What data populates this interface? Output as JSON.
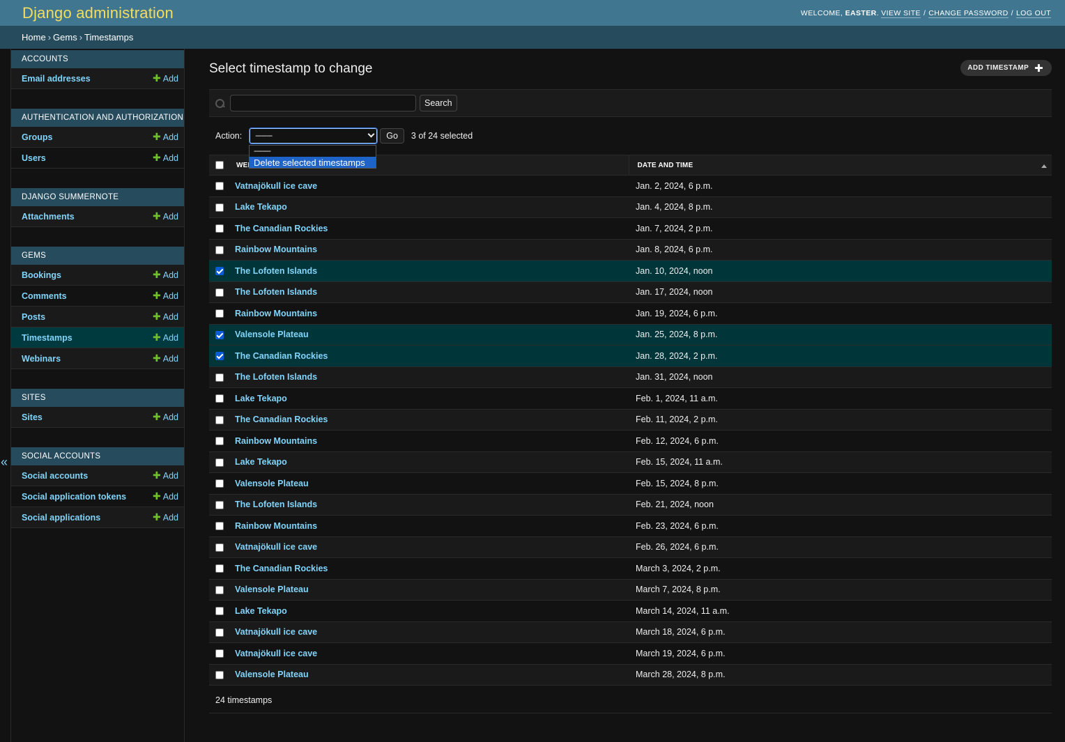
{
  "header": {
    "site_name": "Django administration",
    "welcome": "WELCOME,",
    "username": "EASTER",
    "view_site": "VIEW SITE",
    "change_password": "CHANGE PASSWORD",
    "log_out": "LOG OUT"
  },
  "breadcrumbs": [
    "Home",
    "Gems",
    "Timestamps"
  ],
  "sidebar": {
    "toggle_glyph": "«",
    "add_label": "Add",
    "modules": [
      {
        "caption": "ACCOUNTS",
        "models": [
          "Email addresses"
        ]
      },
      {
        "caption": "AUTHENTICATION AND AUTHORIZATION",
        "models": [
          "Groups",
          "Users"
        ]
      },
      {
        "caption": "DJANGO SUMMERNOTE",
        "models": [
          "Attachments"
        ]
      },
      {
        "caption": "GEMS",
        "models": [
          "Bookings",
          "Comments",
          "Posts",
          "Timestamps",
          "Webinars"
        ]
      },
      {
        "caption": "SITES",
        "models": [
          "Sites"
        ]
      },
      {
        "caption": "SOCIAL ACCOUNTS",
        "models": [
          "Social accounts",
          "Social application tokens",
          "Social applications"
        ]
      }
    ],
    "current_model": "Timestamps"
  },
  "content": {
    "title": "Select timestamp to change",
    "add_button": "ADD TIMESTAMP",
    "search_button": "Search",
    "search_value": "",
    "action_label": "Action:",
    "action_selected": "---------",
    "action_options": [
      "---------",
      "Delete selected timestamps"
    ],
    "go_button": "Go",
    "counter": "3 of 24 selected",
    "columns": [
      "WEBINAR",
      "DATE AND TIME"
    ],
    "rows": [
      {
        "name": "Vatnajökull ice cave",
        "date": "Jan. 2, 2024, 6 p.m.",
        "checked": false
      },
      {
        "name": "Lake Tekapo",
        "date": "Jan. 4, 2024, 8 p.m.",
        "checked": false
      },
      {
        "name": "The Canadian Rockies",
        "date": "Jan. 7, 2024, 2 p.m.",
        "checked": false
      },
      {
        "name": "Rainbow Mountains",
        "date": "Jan. 8, 2024, 6 p.m.",
        "checked": false
      },
      {
        "name": "The Lofoten Islands",
        "date": "Jan. 10, 2024, noon",
        "checked": true
      },
      {
        "name": "The Lofoten Islands",
        "date": "Jan. 17, 2024, noon",
        "checked": false
      },
      {
        "name": "Rainbow Mountains",
        "date": "Jan. 19, 2024, 6 p.m.",
        "checked": false
      },
      {
        "name": "Valensole Plateau",
        "date": "Jan. 25, 2024, 8 p.m.",
        "checked": true
      },
      {
        "name": "The Canadian Rockies",
        "date": "Jan. 28, 2024, 2 p.m.",
        "checked": true
      },
      {
        "name": "The Lofoten Islands",
        "date": "Jan. 31, 2024, noon",
        "checked": false
      },
      {
        "name": "Lake Tekapo",
        "date": "Feb. 1, 2024, 11 a.m.",
        "checked": false
      },
      {
        "name": "The Canadian Rockies",
        "date": "Feb. 11, 2024, 2 p.m.",
        "checked": false
      },
      {
        "name": "Rainbow Mountains",
        "date": "Feb. 12, 2024, 6 p.m.",
        "checked": false
      },
      {
        "name": "Lake Tekapo",
        "date": "Feb. 15, 2024, 11 a.m.",
        "checked": false
      },
      {
        "name": "Valensole Plateau",
        "date": "Feb. 15, 2024, 8 p.m.",
        "checked": false
      },
      {
        "name": "The Lofoten Islands",
        "date": "Feb. 21, 2024, noon",
        "checked": false
      },
      {
        "name": "Rainbow Mountains",
        "date": "Feb. 23, 2024, 6 p.m.",
        "checked": false
      },
      {
        "name": "Vatnajökull ice cave",
        "date": "Feb. 26, 2024, 6 p.m.",
        "checked": false
      },
      {
        "name": "The Canadian Rockies",
        "date": "March 3, 2024, 2 p.m.",
        "checked": false
      },
      {
        "name": "Valensole Plateau",
        "date": "March 7, 2024, 8 p.m.",
        "checked": false
      },
      {
        "name": "Lake Tekapo",
        "date": "March 14, 2024, 11 a.m.",
        "checked": false
      },
      {
        "name": "Vatnajökull ice cave",
        "date": "March 18, 2024, 6 p.m.",
        "checked": false
      },
      {
        "name": "Vatnajökull ice cave",
        "date": "March 19, 2024, 6 p.m.",
        "checked": false
      },
      {
        "name": "Valensole Plateau",
        "date": "March 28, 2024, 8 p.m.",
        "checked": false
      }
    ],
    "paginator": "24 timestamps"
  },
  "colors": {
    "header_bg": "#417690",
    "site_name": "#f5dd5d",
    "breadcrumbs_bg": "#264b5d",
    "link": "#81d4fa",
    "add_icon": "#70bf2b",
    "selected_row": "#00363a"
  },
  "icons": [
    "search-icon",
    "plus-icon",
    "chevron-down-icon",
    "sort-up-icon",
    "collapse-sidebar-icon"
  ]
}
